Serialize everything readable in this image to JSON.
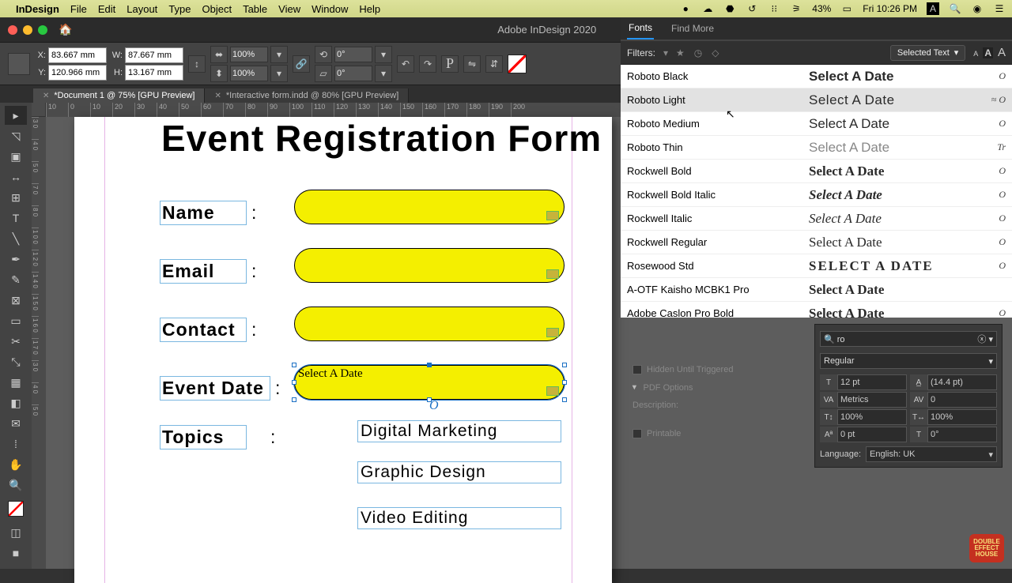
{
  "mac": {
    "app": "InDesign",
    "menus": [
      "File",
      "Edit",
      "Layout",
      "Type",
      "Object",
      "Table",
      "View",
      "Window",
      "Help"
    ],
    "battery": "43%",
    "clock": "Fri 10:26 PM"
  },
  "window": {
    "title": "Adobe InDesign 2020"
  },
  "control": {
    "x_label": "X:",
    "x": "83.667 mm",
    "y_label": "Y:",
    "y": "120.966 mm",
    "w_label": "W:",
    "w": "87.667 mm",
    "h_label": "H:",
    "h": "13.167 mm",
    "scale_x": "100%",
    "scale_y": "100%",
    "rotate": "0°",
    "shear": "0°",
    "pathfinder_p": "P"
  },
  "tabs": [
    {
      "label": "*Document 1 @ 75% [GPU Preview]",
      "active": true
    },
    {
      "label": "*Interactive form.indd @ 80% [GPU Preview]",
      "active": false
    }
  ],
  "ruler_h": [
    "10",
    "0",
    "10",
    "20",
    "30",
    "40",
    "50",
    "60",
    "70",
    "80",
    "90",
    "100",
    "110",
    "120",
    "130",
    "140",
    "150",
    "160",
    "170",
    "180",
    "190",
    "200"
  ],
  "ruler_v": [
    "3 0",
    "4 0",
    "5 0",
    "7 0",
    "8 0",
    "1 0 0",
    "1 2 0",
    "1 4 0",
    "1 5 0",
    "1 6 0",
    "1 7 0",
    "3 0",
    "4 0",
    "5 0"
  ],
  "page": {
    "title": "Event Registration Form",
    "labels": {
      "name": "Name",
      "email": "Email",
      "contact": "Contact",
      "event_date": "Event Date",
      "topics": "Topics"
    },
    "colon": ":",
    "date_placeholder": "Select A Date",
    "topics_list": [
      "Digital Marketing",
      "Graphic Design",
      "Video Editing"
    ]
  },
  "font_panel": {
    "tabs": [
      "Fonts",
      "Find More"
    ],
    "filters_label": "Filters:",
    "selected_text": "Selected Text",
    "list": [
      {
        "name": "Roboto Black",
        "sample": "Select A Date",
        "glyph": "O",
        "css": "font-family: Arial; font-weight:900;"
      },
      {
        "name": "Roboto Light",
        "sample": "Select A Date",
        "glyph": "≈ O",
        "css": "font-family: Arial; font-weight:300; letter-spacing:.5px;",
        "hover": true
      },
      {
        "name": "Roboto Medium",
        "sample": "Select A Date",
        "glyph": "O",
        "css": "font-family: Arial; font-weight:500;"
      },
      {
        "name": "Roboto Thin",
        "sample": "Select A Date",
        "glyph": "Tr",
        "css": "font-family: Arial; font-weight:100; color:#888;"
      },
      {
        "name": "Rockwell Bold",
        "sample": "Select A Date",
        "glyph": "O",
        "css": "font-family: 'Rockwell','Georgia',serif; font-weight:700;"
      },
      {
        "name": "Rockwell Bold Italic",
        "sample": "Select A Date",
        "glyph": "O",
        "css": "font-family: 'Rockwell','Georgia',serif; font-weight:700; font-style:italic;"
      },
      {
        "name": "Rockwell Italic",
        "sample": "Select A Date",
        "glyph": "O",
        "css": "font-family: 'Rockwell','Georgia',serif; font-style:italic;"
      },
      {
        "name": "Rockwell Regular",
        "sample": "Select A Date",
        "glyph": "O",
        "css": "font-family: 'Rockwell','Georgia',serif;"
      },
      {
        "name": "Rosewood Std",
        "sample": "SELECT A DATE",
        "glyph": "O",
        "css": "font-family: serif; font-weight:700; letter-spacing:2px; font-variant:small-caps;"
      },
      {
        "name": "A-OTF Kaisho MCBK1 Pro",
        "sample": "Select A Date",
        "glyph": "",
        "css": "font-family: serif; font-weight:600;"
      },
      {
        "name": "Adobe Caslon Pro Bold",
        "sample": "Select A Date",
        "glyph": "O",
        "css": "font-family: 'Caslon','Georgia',serif; font-weight:700;"
      }
    ]
  },
  "char_panel": {
    "search_prefix": "ro",
    "style": "Regular",
    "size": "12 pt",
    "leading": "(14.4 pt)",
    "kerning": "Metrics",
    "tracking": "0",
    "vscale": "100%",
    "hscale": "100%",
    "baseline": "0 pt",
    "skew": "0°",
    "lang_label": "Language:",
    "lang": "English: UK"
  },
  "interactive": {
    "hidden": "Hidden Until Triggered",
    "pdf": "PDF Options",
    "desc": "Description:",
    "printable": "Printable"
  },
  "badge": "DOUBLE EFFECT HOUSE"
}
